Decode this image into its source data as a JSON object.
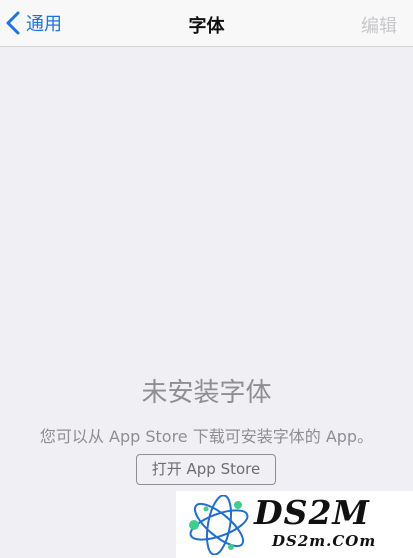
{
  "nav": {
    "back_label": "通用",
    "title": "字体",
    "edit_label": "编辑",
    "back_icon": "chevron-left-icon"
  },
  "empty_state": {
    "title": "未安装字体",
    "description": "您可以从 App Store 下载可安装字体的 App。",
    "button_label": "打开 App Store"
  },
  "watermark": {
    "brand": "DS2M",
    "domain": "DS2m.COm",
    "logo_icon": "atom-logo-icon"
  },
  "colors": {
    "accent": "#1a73e8",
    "disabled": "#c7c7cc",
    "secondary_text": "#8e8e93",
    "background": "#efeff4"
  }
}
